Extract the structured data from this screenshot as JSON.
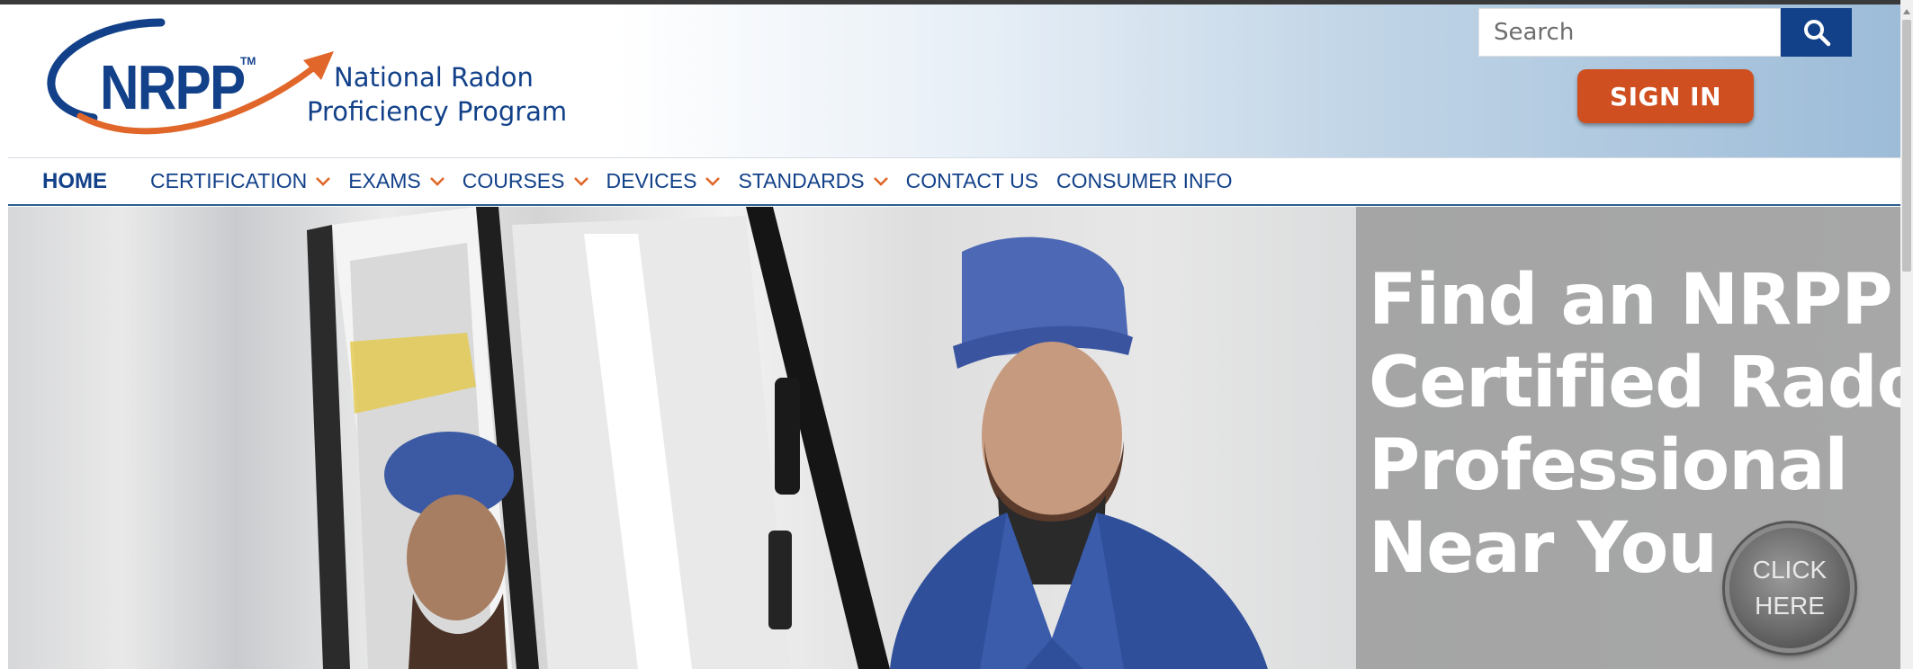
{
  "brand": {
    "mark": "NRPP",
    "trademark": "TM",
    "name_line1": "National Radon",
    "name_line2": "Proficiency Program",
    "colors": {
      "primary": "#12418a",
      "accent": "#e0662a"
    }
  },
  "header": {
    "search": {
      "placeholder": "Search",
      "value": "",
      "button_icon": "search-icon"
    },
    "sign_in_label": "SIGN IN"
  },
  "nav": {
    "items": [
      {
        "label": "HOME",
        "has_dropdown": false,
        "active": true
      },
      {
        "label": "CERTIFICATION",
        "has_dropdown": true
      },
      {
        "label": "EXAMS",
        "has_dropdown": true
      },
      {
        "label": "COURSES",
        "has_dropdown": true
      },
      {
        "label": "DEVICES",
        "has_dropdown": true
      },
      {
        "label": "STANDARDS",
        "has_dropdown": true
      },
      {
        "label": "CONTACT US",
        "has_dropdown": false
      },
      {
        "label": "CONSUMER INFO",
        "has_dropdown": false
      }
    ],
    "dropdown_icon": "chevron-down-icon"
  },
  "hero": {
    "headline": [
      "Find an NRPP",
      "Certified Radon",
      "Professional",
      "Near You"
    ],
    "cta_line1": "CLICK",
    "cta_line2": "HERE"
  }
}
